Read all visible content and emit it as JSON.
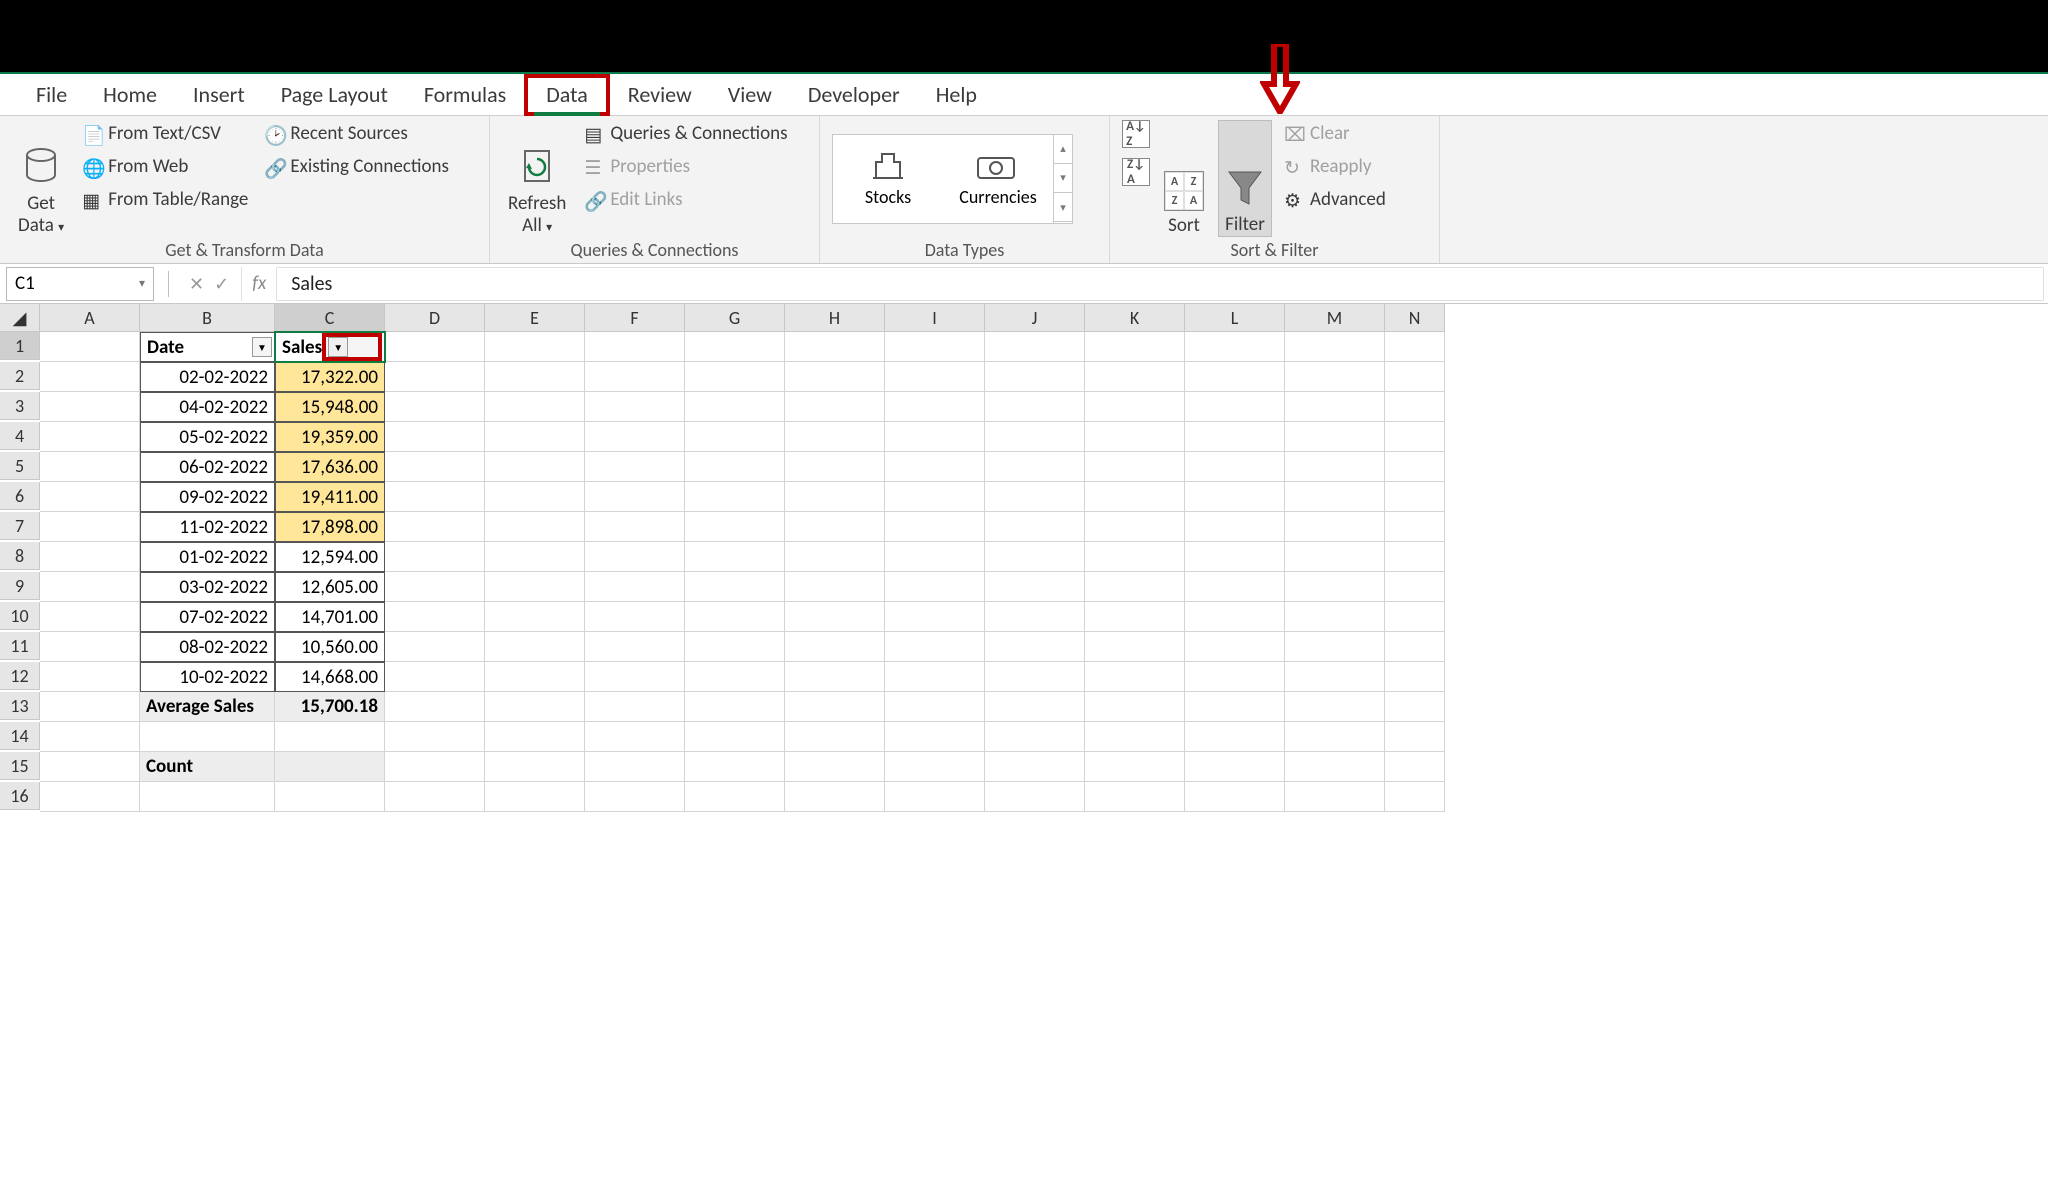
{
  "tabs": [
    "File",
    "Home",
    "Insert",
    "Page Layout",
    "Formulas",
    "Data",
    "Review",
    "View",
    "Developer",
    "Help"
  ],
  "activeTab": "Data",
  "ribbon": {
    "getTransform": {
      "getData": "Get\nData",
      "textCsv": "From Text/CSV",
      "fromWeb": "From Web",
      "fromTable": "From Table/Range",
      "recentSources": "Recent Sources",
      "existingConn": "Existing Connections",
      "label": "Get & Transform Data"
    },
    "queries": {
      "refreshAll": "Refresh\nAll",
      "queriesConn": "Queries & Connections",
      "properties": "Properties",
      "editLinks": "Edit Links",
      "label": "Queries & Connections"
    },
    "dataTypes": {
      "stocks": "Stocks",
      "currencies": "Currencies",
      "label": "Data Types"
    },
    "sortFilter": {
      "sort": "Sort",
      "filter": "Filter",
      "clear": "Clear",
      "reapply": "Reapply",
      "advanced": "Advanced",
      "label": "Sort & Filter"
    }
  },
  "nameBox": "C1",
  "formulaBar": "Sales",
  "columns": [
    "A",
    "B",
    "C",
    "D",
    "E",
    "F",
    "G",
    "H",
    "I",
    "J",
    "K",
    "L",
    "M",
    "N"
  ],
  "rowNumbers": [
    "1",
    "2",
    "3",
    "4",
    "5",
    "6",
    "7",
    "8",
    "9",
    "10",
    "11",
    "12",
    "13",
    "14",
    "15",
    "16"
  ],
  "table": {
    "headers": {
      "date": "Date",
      "sales": "Sales"
    },
    "rows": [
      {
        "date": "02-02-2022",
        "sales": "17,322.00",
        "hl": true
      },
      {
        "date": "04-02-2022",
        "sales": "15,948.00",
        "hl": true
      },
      {
        "date": "05-02-2022",
        "sales": "19,359.00",
        "hl": true
      },
      {
        "date": "06-02-2022",
        "sales": "17,636.00",
        "hl": true
      },
      {
        "date": "09-02-2022",
        "sales": "19,411.00",
        "hl": true
      },
      {
        "date": "11-02-2022",
        "sales": "17,898.00",
        "hl": true
      },
      {
        "date": "01-02-2022",
        "sales": "12,594.00",
        "hl": false
      },
      {
        "date": "03-02-2022",
        "sales": "12,605.00",
        "hl": false
      },
      {
        "date": "07-02-2022",
        "sales": "14,701.00",
        "hl": false
      },
      {
        "date": "08-02-2022",
        "sales": "10,560.00",
        "hl": false
      },
      {
        "date": "10-02-2022",
        "sales": "14,668.00",
        "hl": false
      }
    ],
    "summary1": {
      "label": "Average Sales",
      "value": "15,700.18"
    },
    "summary2": {
      "label": "Count",
      "value": ""
    }
  }
}
